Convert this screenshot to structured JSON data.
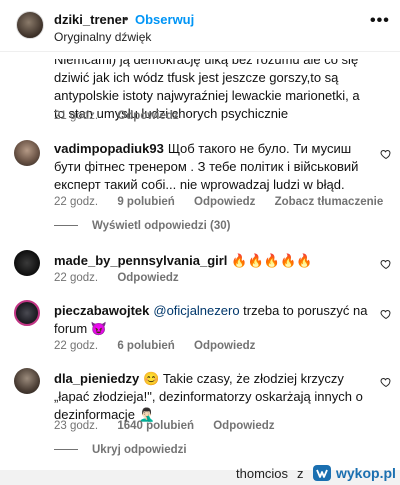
{
  "header": {
    "username": "dziki_trener",
    "separator": "•",
    "follow": "Obserwuj",
    "subtitle": "Oryginalny dźwięk",
    "more": "•••"
  },
  "comments": [
    {
      "username": "",
      "text": "Niemcami) ją demokrację ulką bez rozumu ale co się dziwić jak ich wódz tfusk jest jeszcze gorszy,to są antypolskie istoty najwyraźniej lewackie marionetki, a to stan umysłu ludzi chorych psychicznie",
      "time": "21 godz.",
      "reply": "Odpowiedz"
    },
    {
      "username": "vadimpopadiuk93",
      "text": "Щоб такого не було. Ти мусиш бути фітнес тренером . З тебе політик і військовий експерт такий собі... nie wprowadzaj ludzi w błąd.",
      "time": "22 godz.",
      "likes": "9 polubień",
      "reply": "Odpowiedz",
      "translate": "Zobacz tłumaczenie",
      "view_replies": "Wyświetl odpowiedzi (30)"
    },
    {
      "username": "made_by_pennsylvania_girl",
      "text": "🔥🔥🔥🔥🔥",
      "time": "22 godz.",
      "reply": "Odpowiedz"
    },
    {
      "username": "pieczabawojtek",
      "mention": "@oficjalnezero",
      "text": " trzeba to poruszyć na forum 😈",
      "time": "22 godz.",
      "likes": "6 polubień",
      "reply": "Odpowiedz"
    },
    {
      "username": "dla_pieniedzy",
      "text": "😊 Takie czasy, że złodziej krzyczy „łapać złodzieja!\", dezinformatorzy oskarżają innych o dezinformacje 🤦🏻‍♂️",
      "time": "23 godz.",
      "likes": "1640 polubień",
      "reply": "Odpowiedz",
      "hide_replies": "Ukryj odpowiedzi"
    }
  ],
  "watermark": {
    "user": "thomcios",
    "z": "z",
    "site": "wykop.pl"
  },
  "colors": {
    "link": "#0095f6",
    "mention": "#00376b",
    "meta": "#737373"
  }
}
